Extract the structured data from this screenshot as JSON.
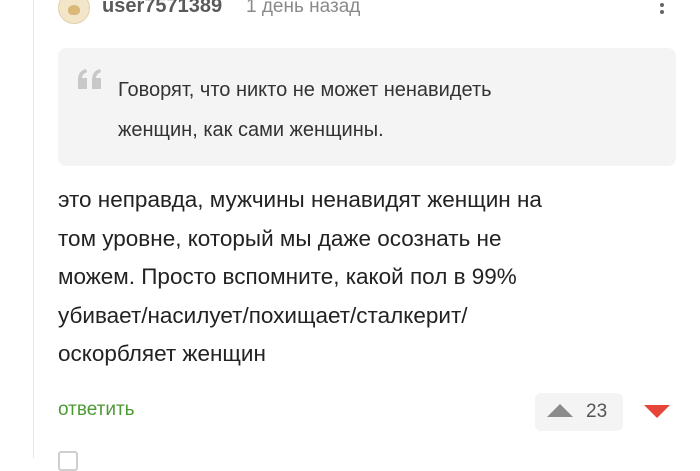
{
  "comment": {
    "username": "user7571389",
    "time": "1 день назад",
    "quote_lines": [
      "Говорят, что никто не может ненавидеть",
      "женщин, как сами женщины."
    ],
    "body_lines": [
      "это неправда, мужчины ненавидят женщин на",
      "том уровне, который мы даже осознать не",
      "можем. Просто вспомните, какой пол в 99%",
      "убивает/насилует/похищает/сталкерит/",
      "оскорбляет женщин"
    ],
    "reply_label": "ответить",
    "rating": "23"
  },
  "icons": {
    "menu": "more-vertical-icon",
    "quote": "quote-icon",
    "upvote": "arrow-up-icon",
    "downvote": "arrow-down-icon"
  },
  "colors": {
    "accent_green": "#4d9a35",
    "downvote_red": "#e8453a",
    "quote_bg": "#f4f4f4"
  }
}
